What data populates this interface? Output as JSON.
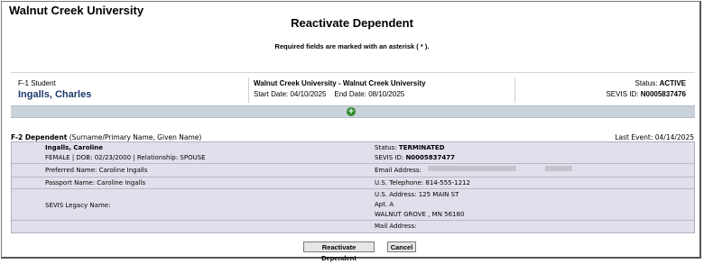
{
  "header": {
    "university": "Walnut Creek University",
    "page_title": "Reactivate Dependent",
    "required_note": "Required fields are marked with an asterisk ( * )."
  },
  "student": {
    "type": "F-1 Student",
    "name": "Ingalls, Charles",
    "school": "Walnut Creek University - Walnut Creek University",
    "dates": "Start Date: 04/10/2025    End Date: 08/10/2025",
    "status_label": "Status:",
    "status_value": "ACTIVE",
    "sevis_label": "SEVIS ID:",
    "sevis_value": "N0005837476"
  },
  "add_icon": "plus-circle-icon",
  "dependent": {
    "section_label": "F-2 Dependent",
    "section_hint": "(Surname/Primary Name, Given Name)",
    "last_event": "Last Event: 04/14/2025",
    "name": "Ingalls, Caroline",
    "details": "FEMALE | DOB: 02/23/2000 | Relationship: SPOUSE",
    "status_label": "Status:",
    "status_value": "TERMINATED",
    "sevis_label": "SEVIS ID:",
    "sevis_value": "N0005837477",
    "preferred_name": "Preferred Name: Caroline Ingalls",
    "email_label": "Email Address:",
    "passport_name": "Passport Name: Caroline Ingalls",
    "telephone": "U.S. Telephone: 814-555-1212",
    "legacy_name": "SEVIS Legacy Name:",
    "address_line1": "U.S. Address: 125 MAIN ST",
    "address_line2": "Apt. A",
    "address_line3": "WALNUT GROVE , MN  56180",
    "mail_address": "Mail Address:"
  },
  "buttons": {
    "reactivate": "Reactivate Dependent",
    "cancel": "Cancel"
  }
}
